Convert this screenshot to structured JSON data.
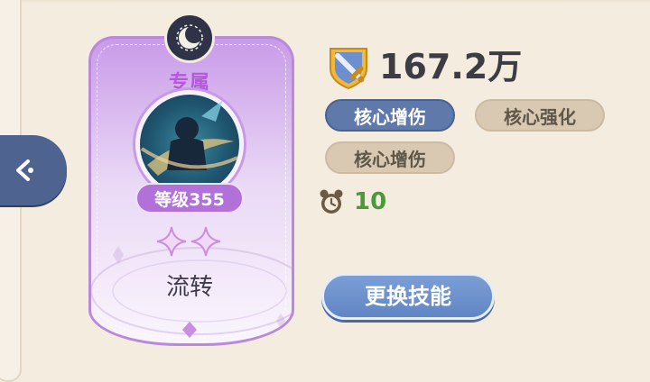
{
  "skill_card": {
    "tier_label": "专属",
    "level_label": "等级355",
    "star_count": 2,
    "name": "流转",
    "badge_icon": "crescent-moon-icon",
    "accent_color": "#b98ad9"
  },
  "stats": {
    "power_value": "167.2万",
    "power_icon": "sword-shield-icon",
    "tags": [
      {
        "label": "核心增伤",
        "style": "blue"
      },
      {
        "label": "核心强化",
        "style": "tan"
      },
      {
        "label": "核心增伤",
        "style": "tan"
      }
    ],
    "cooldown_value": "10",
    "cooldown_icon": "alarm-clock-icon"
  },
  "actions": {
    "change_skill_label": "更换技能",
    "back_icon": "chevron-left-icon"
  }
}
